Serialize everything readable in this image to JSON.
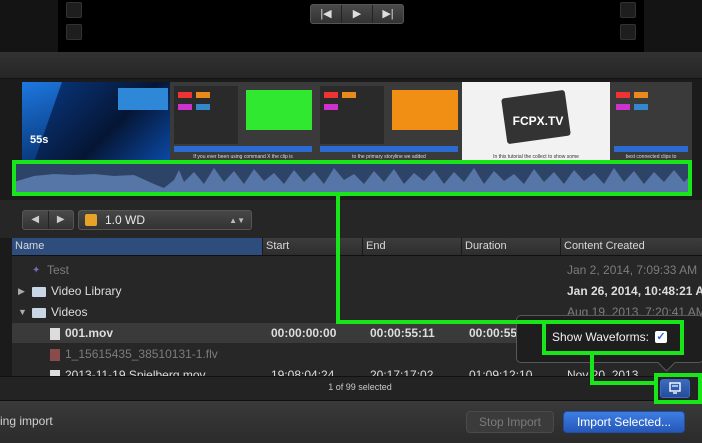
{
  "filmstrip": {
    "timecode": "55s",
    "thumbs": [
      {
        "caption": ""
      },
      {
        "caption": "If you ever been using command X the clip is"
      },
      {
        "caption": "to the primary storyline we added"
      },
      {
        "caption": "In this tutorial the collect to show some"
      },
      {
        "caption": "best connected clips to"
      }
    ],
    "logo_text": "FCPX.TV"
  },
  "path": {
    "back_icon": "◀",
    "forward_icon": "▶",
    "volume": "1.0 WD"
  },
  "table": {
    "columns": [
      "Name",
      "Start",
      "End",
      "Duration",
      "Content Created"
    ],
    "rows": [
      {
        "name": "Test",
        "start": "",
        "end": "",
        "duration": "",
        "created": "Jan 2, 2014, 7:09:33 AM"
      },
      {
        "name": "Video Library",
        "start": "",
        "end": "",
        "duration": "",
        "created": "Jan 26, 2014, 10:48:21 AM"
      },
      {
        "name": "Videos",
        "start": "",
        "end": "",
        "duration": "",
        "created": "Aug 19, 2013, 7:20:41 AM"
      },
      {
        "name": "001.mov",
        "start": "00:00:00:00",
        "end": "00:00:55:11",
        "duration": "00:00:55",
        "created": ""
      },
      {
        "name": "1_15615435_38510131-1.flv",
        "start": "",
        "end": "",
        "duration": "",
        "created": ""
      },
      {
        "name": "2013-11-19 Spielberg.mov",
        "start": "19:08:04:24",
        "end": "20:17:17:02",
        "duration": "01:09:12:10",
        "created": "Nov 20, 2013"
      }
    ]
  },
  "browser_footer": {
    "selection_count": "1 of 99 selected"
  },
  "bottom_bar": {
    "status_text": "ing import",
    "stop_import": "Stop Import",
    "import_selected": "Import Selected..."
  },
  "popover": {
    "label": "Show Waveforms:",
    "checked": true,
    "check_glyph": "✓"
  },
  "transport": {
    "prev_icon": "|◀",
    "play_icon": "▶",
    "next_icon": "▶|"
  },
  "colors": {
    "highlight": "#19e619",
    "accent": "#2a6ad8",
    "waveform": "#2e4466"
  }
}
